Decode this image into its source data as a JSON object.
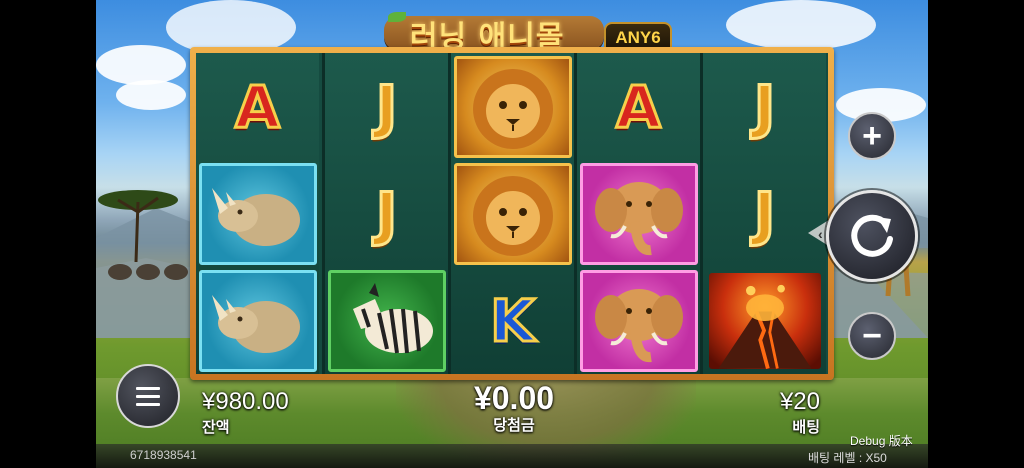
{
  "game": {
    "title": "러닝 애니몰",
    "badge": "ANY6"
  },
  "reels": [
    [
      {
        "symbol": "A"
      },
      {
        "symbol": "rhino"
      },
      {
        "symbol": "rhino"
      }
    ],
    [
      {
        "symbol": "J"
      },
      {
        "symbol": "J"
      },
      {
        "symbol": "zebra"
      }
    ],
    [
      {
        "symbol": "lion"
      },
      {
        "symbol": "lion"
      },
      {
        "symbol": "K"
      }
    ],
    [
      {
        "symbol": "A"
      },
      {
        "symbol": "elephant"
      },
      {
        "symbol": "elephant"
      }
    ],
    [
      {
        "symbol": "J"
      },
      {
        "symbol": "J"
      },
      {
        "symbol": "volcano"
      }
    ]
  ],
  "controls": {
    "plus_glyph": "+",
    "minus_glyph": "−",
    "spin_icon": "refresh-icon",
    "menu_icon": "hamburger-icon"
  },
  "balance": {
    "value": "¥980.00",
    "label": "잔액"
  },
  "win": {
    "value": "¥0.00",
    "label": "당첨금"
  },
  "bet": {
    "value": "¥20",
    "label": "배팅"
  },
  "footer": {
    "session_id": "6718938541",
    "debug": "Debug 版本",
    "bet_level": "배팅 레벨 : X50"
  },
  "colors": {
    "frame": "#e49a35",
    "reel_bg": "#154b40",
    "lion_tile": "#d68a1f",
    "rhino_tile": "#1f8fb2",
    "elephant_tile": "#c22fa4",
    "zebra_tile": "#1e7a2a"
  }
}
